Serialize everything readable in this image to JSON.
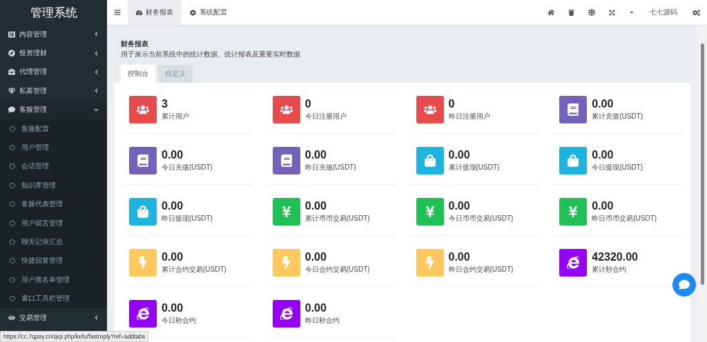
{
  "sidebar": {
    "title": "管理系统",
    "items": [
      {
        "label": "内容管理",
        "expanded": false
      },
      {
        "label": "投资理财",
        "expanded": false
      },
      {
        "label": "代理管理",
        "expanded": false
      },
      {
        "label": "私募管理",
        "expanded": false
      },
      {
        "label": "客服管理",
        "expanded": true,
        "children": [
          {
            "label": "客服配置"
          },
          {
            "label": "用户管理"
          },
          {
            "label": "会话管理"
          },
          {
            "label": "知识库管理"
          },
          {
            "label": "客服代表管理"
          },
          {
            "label": "用户留言管理"
          },
          {
            "label": "聊天记录汇总"
          },
          {
            "label": "快捷回复管理"
          },
          {
            "label": "用户黑名单管理"
          },
          {
            "label": "窗口工具栏管理"
          }
        ]
      },
      {
        "label": "交易管理",
        "expanded": false
      }
    ]
  },
  "top_tabs": [
    {
      "label": "财务报表",
      "selected": true
    },
    {
      "label": "系统配置",
      "selected": false
    }
  ],
  "user": {
    "name": "七七源码"
  },
  "panel": {
    "title": "财务报表",
    "description": "用于展示当前系统中的统计数据、统计报表及重要实时数据",
    "tabs": [
      {
        "label": "控制台",
        "selected": true
      },
      {
        "label": "自定义",
        "selected": false
      }
    ]
  },
  "stats": [
    {
      "value": "3",
      "label": "累计用户",
      "kind": "users"
    },
    {
      "value": "0",
      "label": "今日注册用户",
      "kind": "users"
    },
    {
      "value": "0",
      "label": "昨日注册用户",
      "kind": "users"
    },
    {
      "value": "0.00",
      "label": "累计充值(USDT)",
      "kind": "book"
    },
    {
      "value": "0.00",
      "label": "今日充值(USDT)",
      "kind": "book"
    },
    {
      "value": "0.00",
      "label": "昨日充值(USDT)",
      "kind": "book"
    },
    {
      "value": "0.00",
      "label": "累计提现(USDT)",
      "kind": "bag"
    },
    {
      "value": "0.00",
      "label": "今日提现(USDT)",
      "kind": "bag"
    },
    {
      "value": "0.00",
      "label": "昨日提现(USDT)",
      "kind": "bag"
    },
    {
      "value": "0.00",
      "label": "累计币币交易(USDT)",
      "kind": "yen"
    },
    {
      "value": "0.00",
      "label": "今日币币交易(USDT)",
      "kind": "yen"
    },
    {
      "value": "0.00",
      "label": "昨日币币交易(USDT)",
      "kind": "yen"
    },
    {
      "value": "0.00",
      "label": "累计合约交易(USDT)",
      "kind": "bolt"
    },
    {
      "value": "0.00",
      "label": "今日合约交易(USDT)",
      "kind": "bolt"
    },
    {
      "value": "0.00",
      "label": "昨日合约交易(USDT)",
      "kind": "bolt"
    },
    {
      "value": "42320.00",
      "label": "累计秒合约",
      "kind": "orbit"
    },
    {
      "value": "0.00",
      "label": "今日秒合约",
      "kind": "orbit"
    },
    {
      "value": "0.00",
      "label": "昨日秒合约",
      "kind": "orbit"
    }
  ],
  "status_url": "https://cc.7qpay.cn/qiqi.php/kefu/fastreply?ref=addtabs"
}
